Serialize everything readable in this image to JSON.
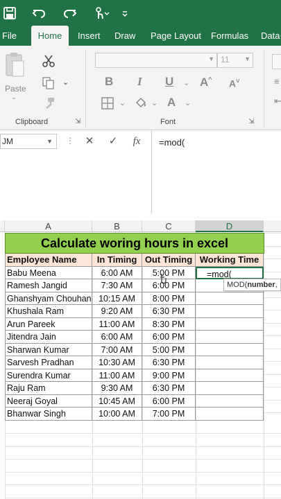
{
  "quick_access": {
    "icons": [
      "save-icon",
      "undo-icon",
      "redo-icon",
      "touch-mode-icon",
      "customize-icon"
    ]
  },
  "tabs": [
    "File",
    "Home",
    "Insert",
    "Draw",
    "Page Layout",
    "Formulas",
    "Data"
  ],
  "active_tab": "Home",
  "ribbon": {
    "clipboard": {
      "paste_label": "Paste",
      "group_label": "Clipboard"
    },
    "font": {
      "font_size": "11",
      "group_label": "Font",
      "bold": "B",
      "italic": "I",
      "underline": "U"
    }
  },
  "formula_bar": {
    "name_box": "JM",
    "formula": "=mod("
  },
  "sheet": {
    "columns": [
      "A",
      "B",
      "C",
      "D"
    ],
    "selected_column": "D",
    "title": "Calculate woring hours in excel",
    "headers": [
      "Employee Name",
      "In Timing",
      "Out Timing",
      "Working Time"
    ],
    "rows": [
      {
        "name": "Babu Meena",
        "in": "6:00 AM",
        "out": "5:00 PM",
        "work": "=mod("
      },
      {
        "name": "Ramesh Jangid",
        "in": "7:30 AM",
        "out": "6:00 PM",
        "work": ""
      },
      {
        "name": "Ghanshyam Chouhan",
        "in": "10:15 AM",
        "out": "8:00 PM",
        "work": ""
      },
      {
        "name": "Khushala Ram",
        "in": "9:20 AM",
        "out": "6:30 PM",
        "work": ""
      },
      {
        "name": "Arun Pareek",
        "in": "11:00 AM",
        "out": "8:30 PM",
        "work": ""
      },
      {
        "name": "Jitendra Jain",
        "in": "6:00 AM",
        "out": "6:00 PM",
        "work": ""
      },
      {
        "name": "Sharwan Kumar",
        "in": "7:00 AM",
        "out": "5:00 PM",
        "work": ""
      },
      {
        "name": "Sarvesh Pradhan",
        "in": "10:30 AM",
        "out": "6:30 PM",
        "work": ""
      },
      {
        "name": "Surendra Kumar",
        "in": "11:00 AM",
        "out": "9:00 PM",
        "work": ""
      },
      {
        "name": "Raju Ram",
        "in": "9:30 AM",
        "out": "6:30 PM",
        "work": ""
      },
      {
        "name": "Neeraj Goyal",
        "in": "10:45 AM",
        "out": "6:00 PM",
        "work": ""
      },
      {
        "name": "Bhanwar Singh",
        "in": "10:00 AM",
        "out": "7:00 PM",
        "work": ""
      }
    ],
    "tooltip": {
      "fn": "MOD(",
      "arg": "number",
      "rest": ","
    }
  },
  "colors": {
    "excel_green": "#217346",
    "title_fill": "#92d050",
    "header_fill": "#fce4d6"
  }
}
